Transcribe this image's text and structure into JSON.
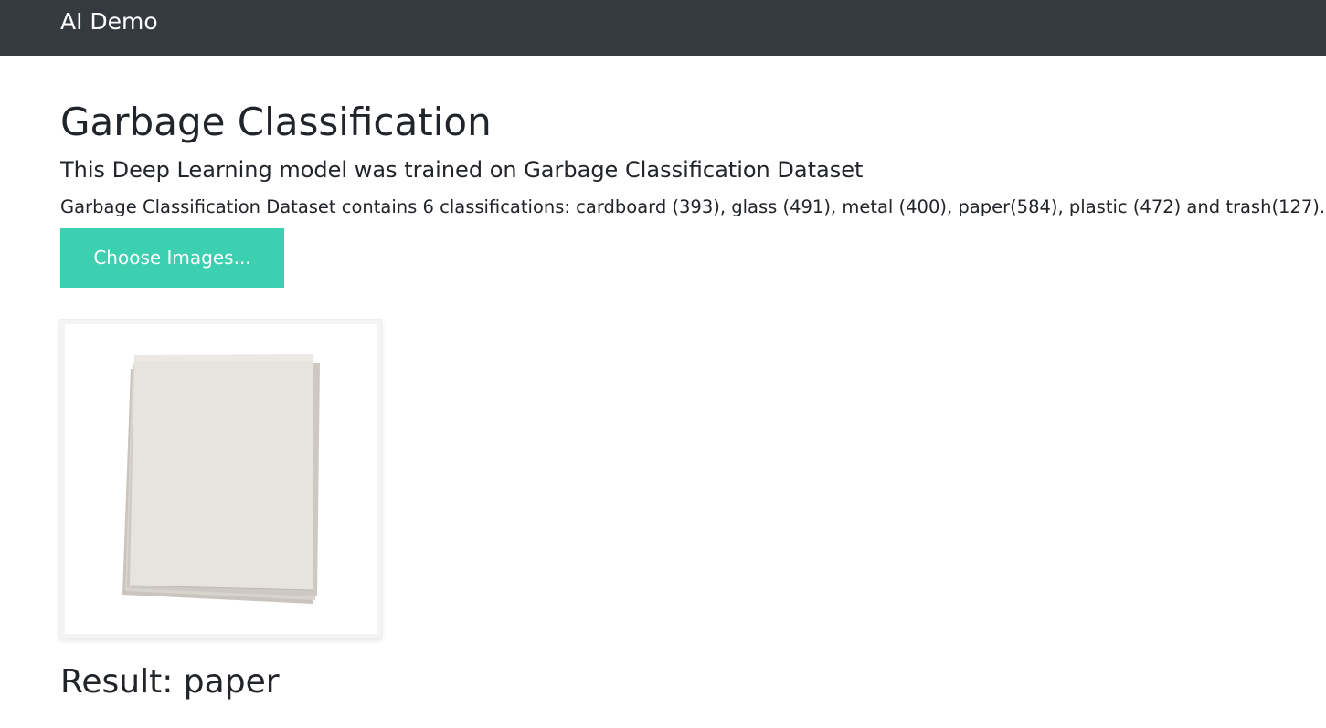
{
  "navbar": {
    "brand": "AI Demo"
  },
  "main": {
    "title": "Garbage Classification",
    "subtitle": "This Deep Learning model was trained on Garbage Classification Dataset",
    "description": "Garbage Classification Dataset contains 6 classifications: cardboard (393), glass (491), metal (400), paper(584), plastic (472) and trash(127).",
    "choose_button_label": "Choose Images...",
    "result_text": "Result: paper"
  },
  "colors": {
    "navbar_bg": "#343a40",
    "button_bg": "#3ccfb0",
    "text": "#212529"
  },
  "preview": {
    "icon": "paper-stack-image"
  }
}
